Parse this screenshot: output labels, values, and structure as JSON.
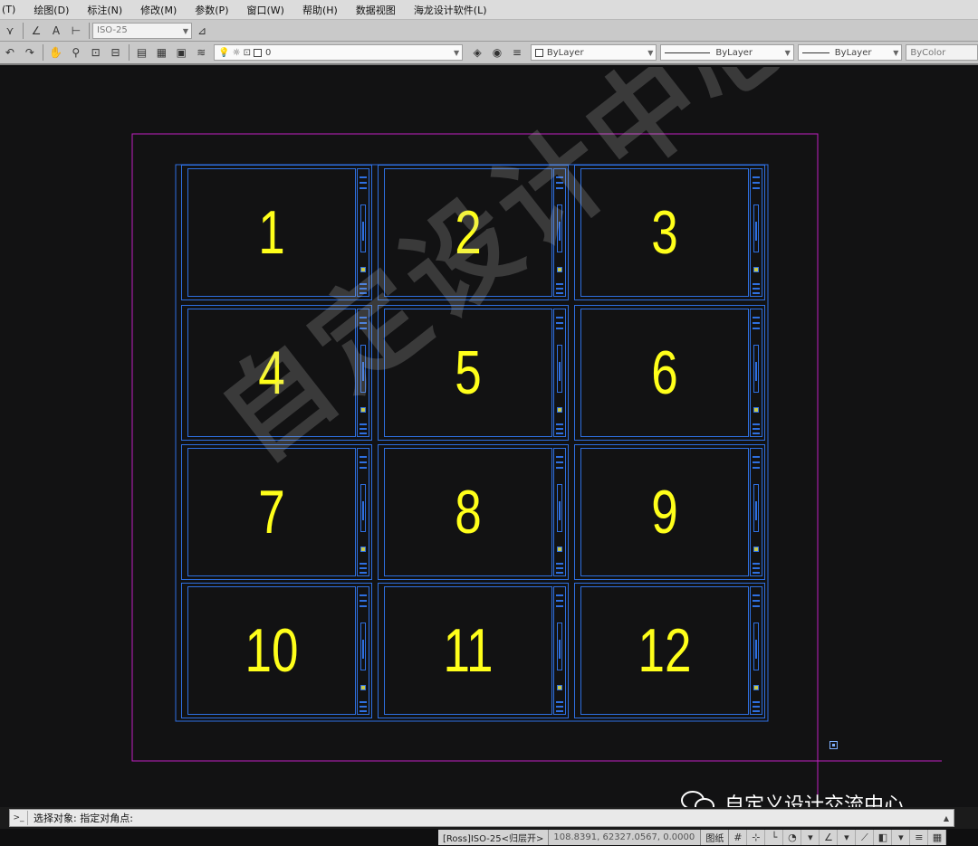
{
  "menu": [
    "(T)",
    "绘图(D)",
    "标注(N)",
    "修改(M)",
    "参数(P)",
    "窗口(W)",
    "帮助(H)",
    "数据视图",
    "海龙设计软件(L)"
  ],
  "toolbar1": {
    "dimstyle": "ISO-25"
  },
  "toolbar2": {
    "layer_value": "0",
    "color_value": "ByLayer",
    "linetype_value": "ByLayer",
    "lineweight_value": "ByLayer",
    "plotstyle_value": "ByColor"
  },
  "drawing": {
    "panels": [
      "1",
      "2",
      "3",
      "4",
      "5",
      "6",
      "7",
      "8",
      "9",
      "10",
      "11",
      "12"
    ],
    "watermark": "自定设计中心"
  },
  "wechat_label": "自定义设计交流中心",
  "command": {
    "text": "选择对象: 指定对角点:"
  },
  "status": {
    "style": "[Ross]ISO-25<归层开>",
    "coords": "108.8391, 62327.0567, 0.0000",
    "space": "图纸"
  },
  "colors": {
    "canvas": "#121213",
    "panel_blue": "#2e6fe0",
    "number_yellow": "#ffff1a",
    "border_magenta": "#c020c0"
  }
}
